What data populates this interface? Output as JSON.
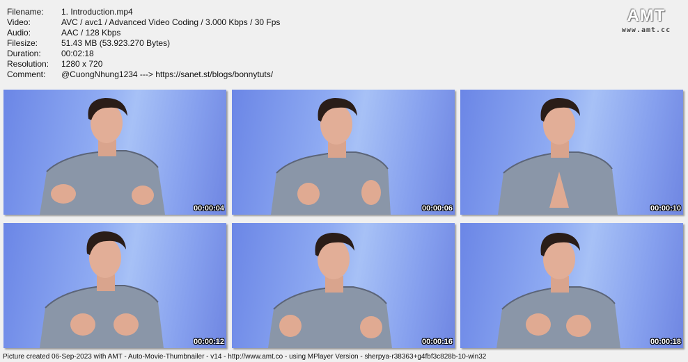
{
  "info": [
    {
      "key": "Filename:",
      "value": "1. Introduction.mp4"
    },
    {
      "key": "Video:",
      "value": "AVC / avc1 / Advanced Video Coding / 3.000 Kbps / 30 Fps"
    },
    {
      "key": "Audio:",
      "value": "AAC / 128 Kbps"
    },
    {
      "key": "Filesize:",
      "value": "51.43 MB (53.923.270 Bytes)"
    },
    {
      "key": "Duration:",
      "value": "00:02:18"
    },
    {
      "key": "Resolution:",
      "value": "1280 x 720"
    },
    {
      "key": "Comment:",
      "value": "@CuongNhung1234 ---> https://sanet.st/blogs/bonnytuts/"
    }
  ],
  "logo": {
    "main": "AMT",
    "sub": "www.amt.cc"
  },
  "thumbnails": [
    {
      "timestamp": "00:00:04"
    },
    {
      "timestamp": "00:00:06"
    },
    {
      "timestamp": "00:00:10"
    },
    {
      "timestamp": "00:00:12"
    },
    {
      "timestamp": "00:00:16"
    },
    {
      "timestamp": "00:00:18"
    }
  ],
  "footer": "Picture created 06-Sep-2023 with AMT - Auto-Movie-Thumbnailer - v14 - http://www.amt.co - using MPlayer Version - sherpya-r38363+g4fbf3c828b-10-win32"
}
